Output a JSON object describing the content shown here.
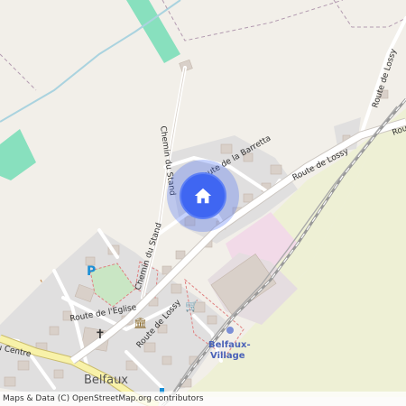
{
  "map": {
    "places": {
      "village": "Belfaux",
      "station_line1": "Belfaux-",
      "station_line2": "Village"
    },
    "streets": {
      "route_de_la_barretta": "Route de la Barretta",
      "chemin_du_stand_north": "Chemin du Stand",
      "chemin_du_stand_south": "Chemin du Stand",
      "route_de_lossy_east": "Route de Lossy",
      "route_de_lossy_northeast": "Route de Lossy",
      "route_de_lossy_south": "Route de Lossy",
      "route_de_l_eglise": "Route de l'Eglise",
      "route_du_centre": "Route du Centre",
      "route_edge": "Route"
    },
    "pois": {
      "parking": "P",
      "church": "✝",
      "museum": "🏛",
      "shop": "🛒"
    },
    "marker": {
      "icon": "home-icon",
      "color": "#3f66f2"
    }
  },
  "attribution": {
    "prefix": "Maps & Data (C)",
    "link": "OpenStreetMap.org contributors"
  }
}
